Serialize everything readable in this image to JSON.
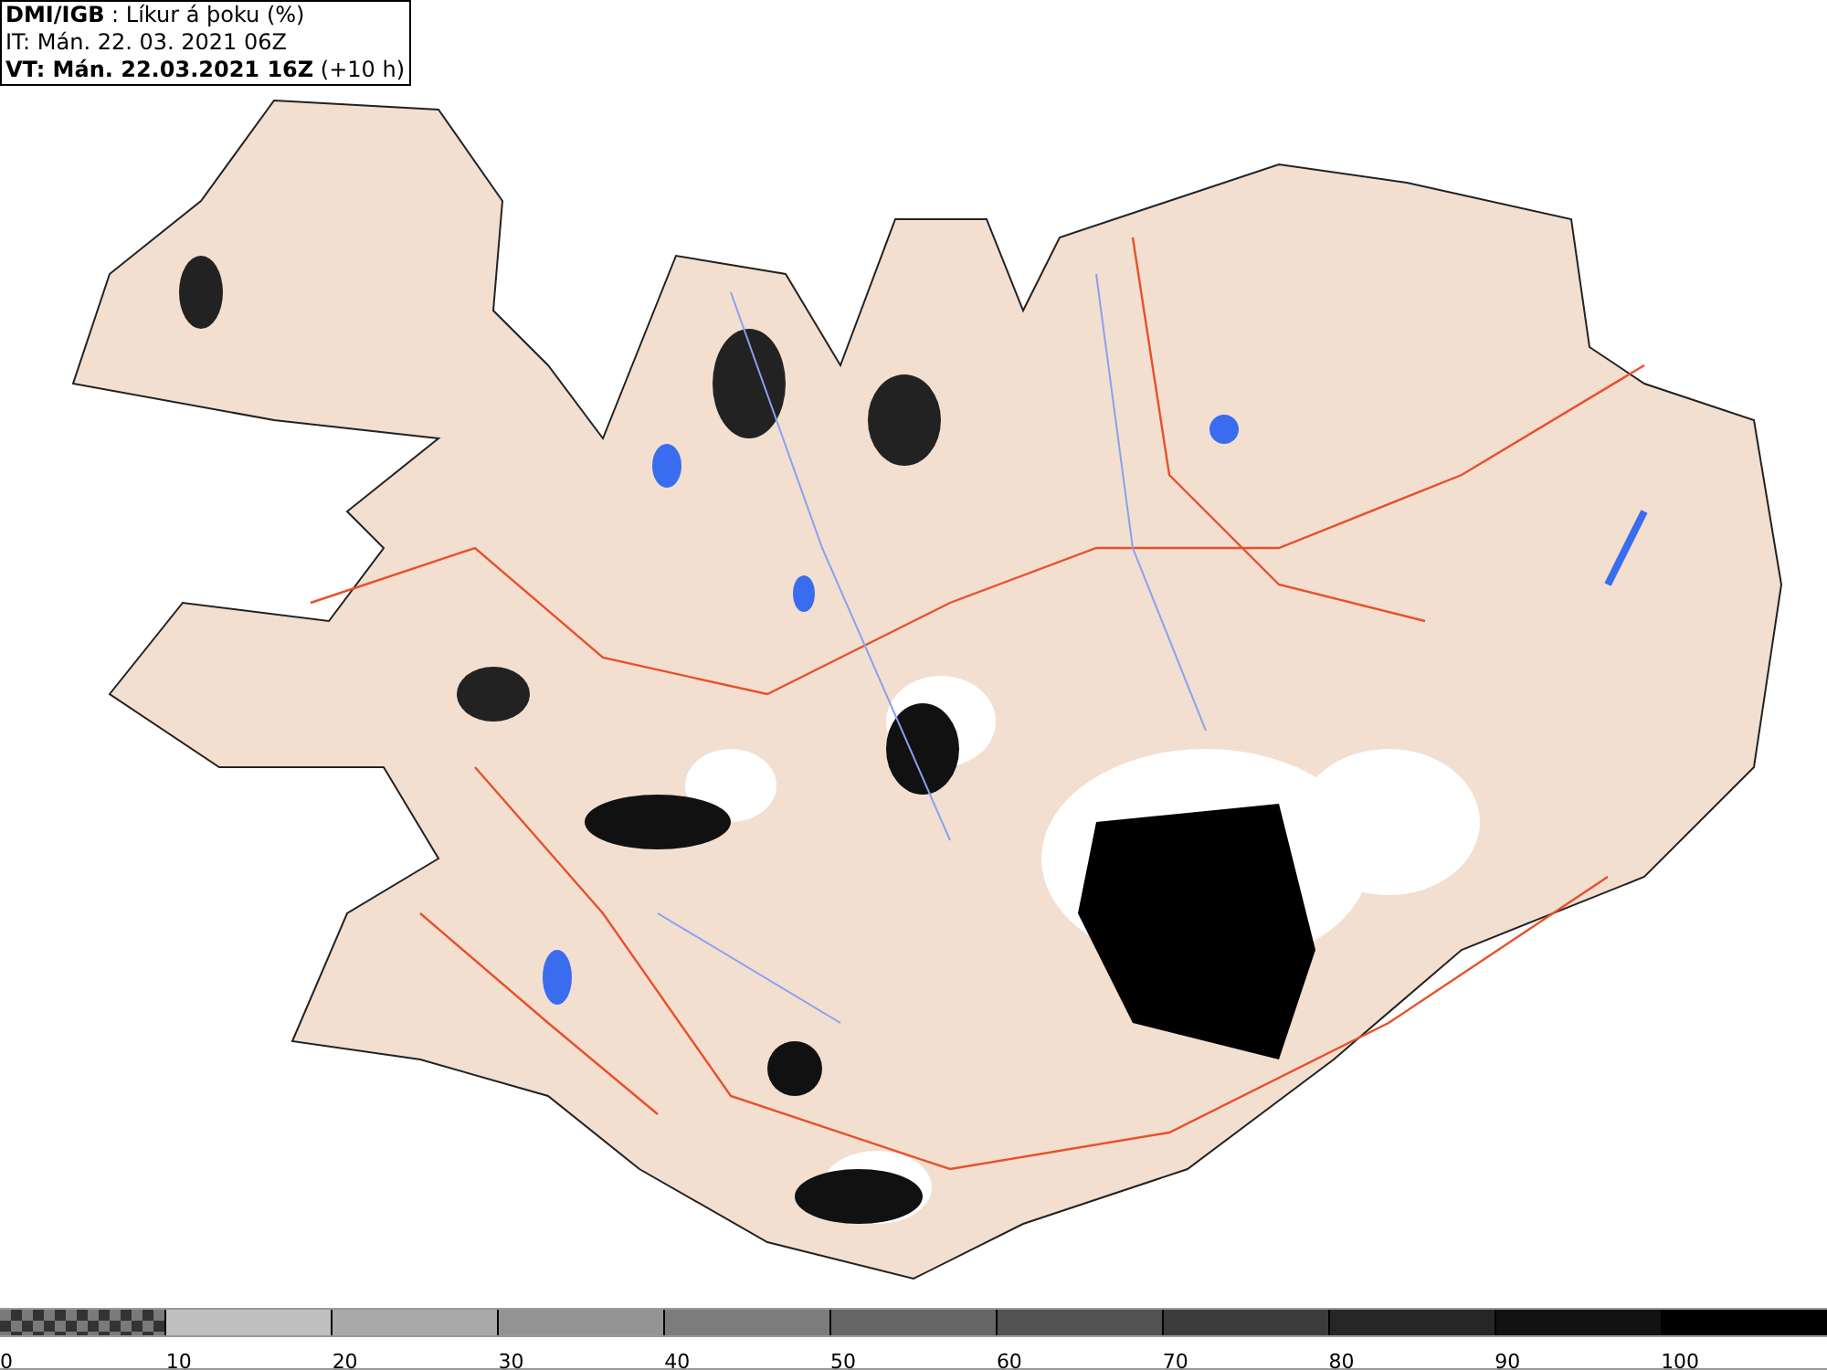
{
  "header": {
    "title_line": "**DMI/IGB** : Líkur á þoku (%)",
    "it_line": "IT: Mán. 22. 03. 2021 06Z",
    "vt_line": "**VT: Mán. 22.03.2021 16Z** (+10 h)"
  },
  "legend": {
    "segments": [
      {
        "kind": "checker",
        "color": "#7a7a7a"
      },
      {
        "kind": "solid",
        "color": "#c0c0c0"
      },
      {
        "kind": "solid",
        "color": "#a9a9a9"
      },
      {
        "kind": "solid",
        "color": "#939393"
      },
      {
        "kind": "solid",
        "color": "#7c7c7c"
      },
      {
        "kind": "solid",
        "color": "#666666"
      },
      {
        "kind": "solid",
        "color": "#525252"
      },
      {
        "kind": "solid",
        "color": "#3c3c3c"
      },
      {
        "kind": "solid",
        "color": "#262626"
      },
      {
        "kind": "solid",
        "color": "#121212"
      },
      {
        "kind": "solid",
        "color": "#000000"
      }
    ],
    "labels": [
      "0",
      "10",
      "20",
      "30",
      "40",
      "50",
      "60",
      "70",
      "80",
      "90",
      "100"
    ]
  }
}
